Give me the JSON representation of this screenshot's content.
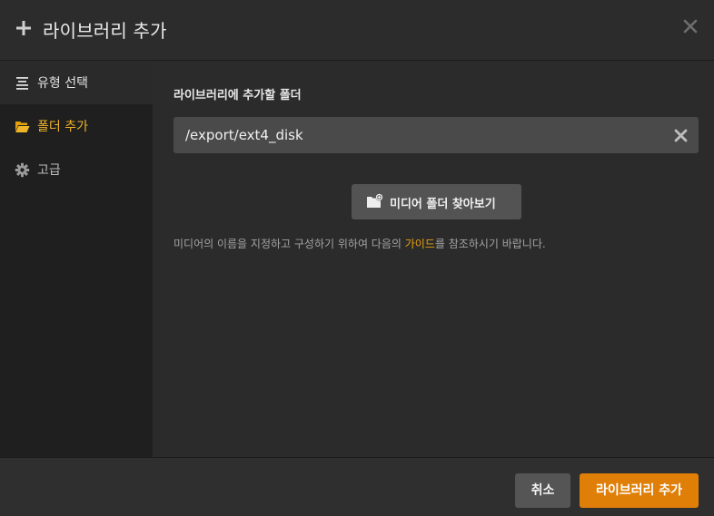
{
  "header": {
    "title": "라이브러리 추가",
    "icon": "plus-icon",
    "close_icon": "close-icon"
  },
  "sidebar": {
    "items": [
      {
        "label": "유형 선택",
        "icon": "list-icon"
      },
      {
        "label": "폴더 추가",
        "icon": "folder-open-icon"
      },
      {
        "label": "고급",
        "icon": "gear-icon"
      }
    ]
  },
  "main": {
    "section_label": "라이브러리에 추가할 폴더",
    "folder_path": "/export/ext4_disk",
    "clear_icon": "clear-icon",
    "browse_label": "미디어 폴더 찾아보기",
    "browse_icon": "folder-add-icon",
    "hint_before": "미디어의 이름을 지정하고 구성하기 위하여 다음의 ",
    "hint_link": "가이드",
    "hint_after": "를 참조하시기 바랍니다."
  },
  "footer": {
    "cancel_label": "취소",
    "submit_label": "라이브러리 추가"
  },
  "colors": {
    "accent": "#e07f08",
    "selected_text": "#f0b429",
    "link": "#e5a00d"
  }
}
